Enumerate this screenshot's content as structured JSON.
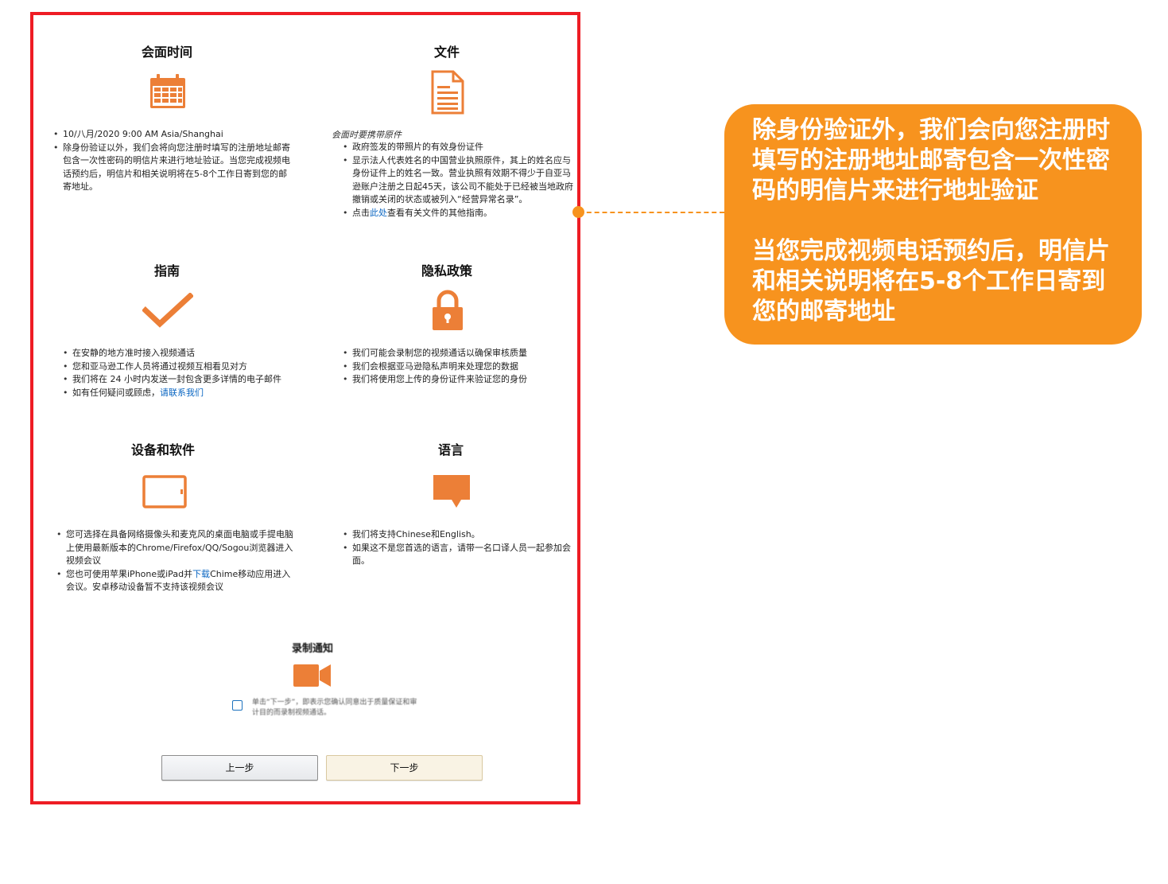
{
  "sections": {
    "meeting_time": {
      "title": "会面时间",
      "items": [
        "10/八月/2020 9:00 AM Asia/Shanghai",
        "除身份验证以外，我们会将向您注册时填写的注册地址邮寄包含一次性密码的明信片来进行地址验证。当您完成视频电话预约后，明信片和相关说明将在5-8个工作日寄到您的邮寄地址。"
      ]
    },
    "documents": {
      "title": "文件",
      "note": "会面时要携带原件",
      "items": [
        "政府签发的带照片的有效身份证件",
        "显示法人代表姓名的中国营业执照原件，其上的姓名应与身份证件上的姓名一致。营业执照有效期不得少于自亚马逊账户注册之日起45天，该公司不能处于已经被当地政府撤销或关闭的状态或被列入“经营异常名录”。"
      ],
      "link_item": {
        "prefix": "点击",
        "link": "此处",
        "suffix": "查看有关文件的其他指南。"
      }
    },
    "guide": {
      "title": "指南",
      "items": [
        "在安静的地方准时接入视频通话",
        "您和亚马逊工作人员将通过视频互相看见对方",
        "我们将在 24 小时内发送一封包含更多详情的电子邮件"
      ],
      "link_item": {
        "prefix": "如有任何疑问或顾虑，",
        "link": "请联系我们"
      }
    },
    "privacy": {
      "title": "隐私政策",
      "items": [
        "我们可能会录制您的视频通话以确保审核质量",
        "我们会根据亚马逊隐私声明来处理您的数据",
        "我们将使用您上传的身份证件来验证您的身份"
      ]
    },
    "devices": {
      "title": "设备和软件",
      "item1": "您可选择在具备网络摄像头和麦克风的桌面电脑或手提电脑上使用最新版本的Chrome/Firefox/QQ/Sogou浏览器进入视频会议",
      "item2": {
        "prefix": "您也可使用苹果iPhone或iPad并",
        "link": "下载",
        "suffix": "Chime移动应用进入会议。安卓移动设备暂不支持该视频会议"
      }
    },
    "language": {
      "title": "语言",
      "items": [
        "我们将支持Chinese和English。",
        "如果这不是您首选的语言，请带一名口译人员一起参加会面。"
      ]
    },
    "recording": {
      "title": "录制通知",
      "consent": "单击“下一步”，即表示您确认同意出于质量保证和审计目的而录制视频通话。"
    }
  },
  "buttons": {
    "prev": "上一步",
    "next": "下一步"
  },
  "callout": {
    "paragraph1": "除身份验证外，我们会向您注册时填写的注册地址邮寄包含一次性密码的明信片来进行地址验证",
    "paragraph2": "当您完成视频电话预约后，明信片和相关说明将在5-8个工作日寄到您的邮寄地址"
  },
  "colors": {
    "accent": "#f7931e",
    "icon": "#ec7f37",
    "frame": "#ee1c24",
    "link": "#0a66c2"
  }
}
